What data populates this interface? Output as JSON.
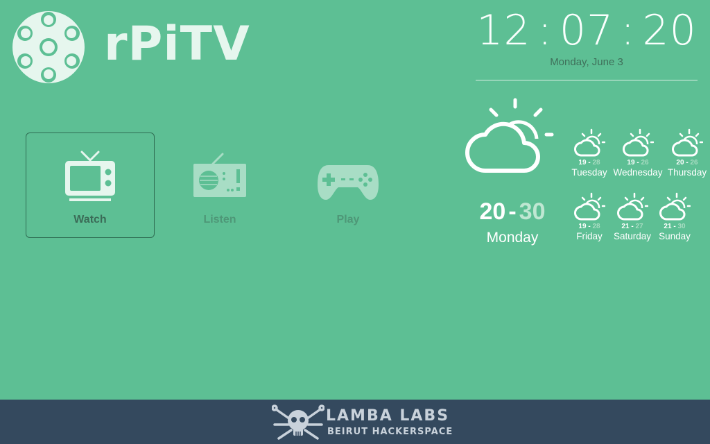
{
  "app": {
    "logo_text": "rPiTV"
  },
  "menu": [
    {
      "label": "Watch",
      "selected": true
    },
    {
      "label": "Listen",
      "selected": false
    },
    {
      "label": "Play",
      "selected": false
    }
  ],
  "clock": {
    "hours": "12",
    "minutes": "07",
    "seconds": "20",
    "separator": ":"
  },
  "date": "Monday, June 3",
  "weather": {
    "today": {
      "low": "20",
      "high": "30",
      "day": "Monday",
      "icon": "partly-cloudy-icon"
    },
    "forecast": [
      {
        "low": "19",
        "high": "28",
        "day": "Tuesday",
        "icon": "partly-cloudy-icon"
      },
      {
        "low": "19",
        "high": "26",
        "day": "Wednesday",
        "icon": "partly-cloudy-icon"
      },
      {
        "low": "20",
        "high": "26",
        "day": "Thursday",
        "icon": "partly-cloudy-icon"
      },
      {
        "low": "19",
        "high": "28",
        "day": "Friday",
        "icon": "partly-cloudy-icon"
      },
      {
        "low": "21",
        "high": "27",
        "day": "Saturday",
        "icon": "partly-cloudy-icon"
      },
      {
        "low": "21",
        "high": "30",
        "day": "Sunday",
        "icon": "partly-cloudy-icon"
      }
    ],
    "dash": "-"
  },
  "footer": {
    "brand_line1": "LAMBA LABS",
    "brand_line2": "BEIRUT HACKERSPACE"
  },
  "colors": {
    "background": "#5dbf94",
    "footer": "#34495e",
    "selected_border": "#2f6d53"
  }
}
